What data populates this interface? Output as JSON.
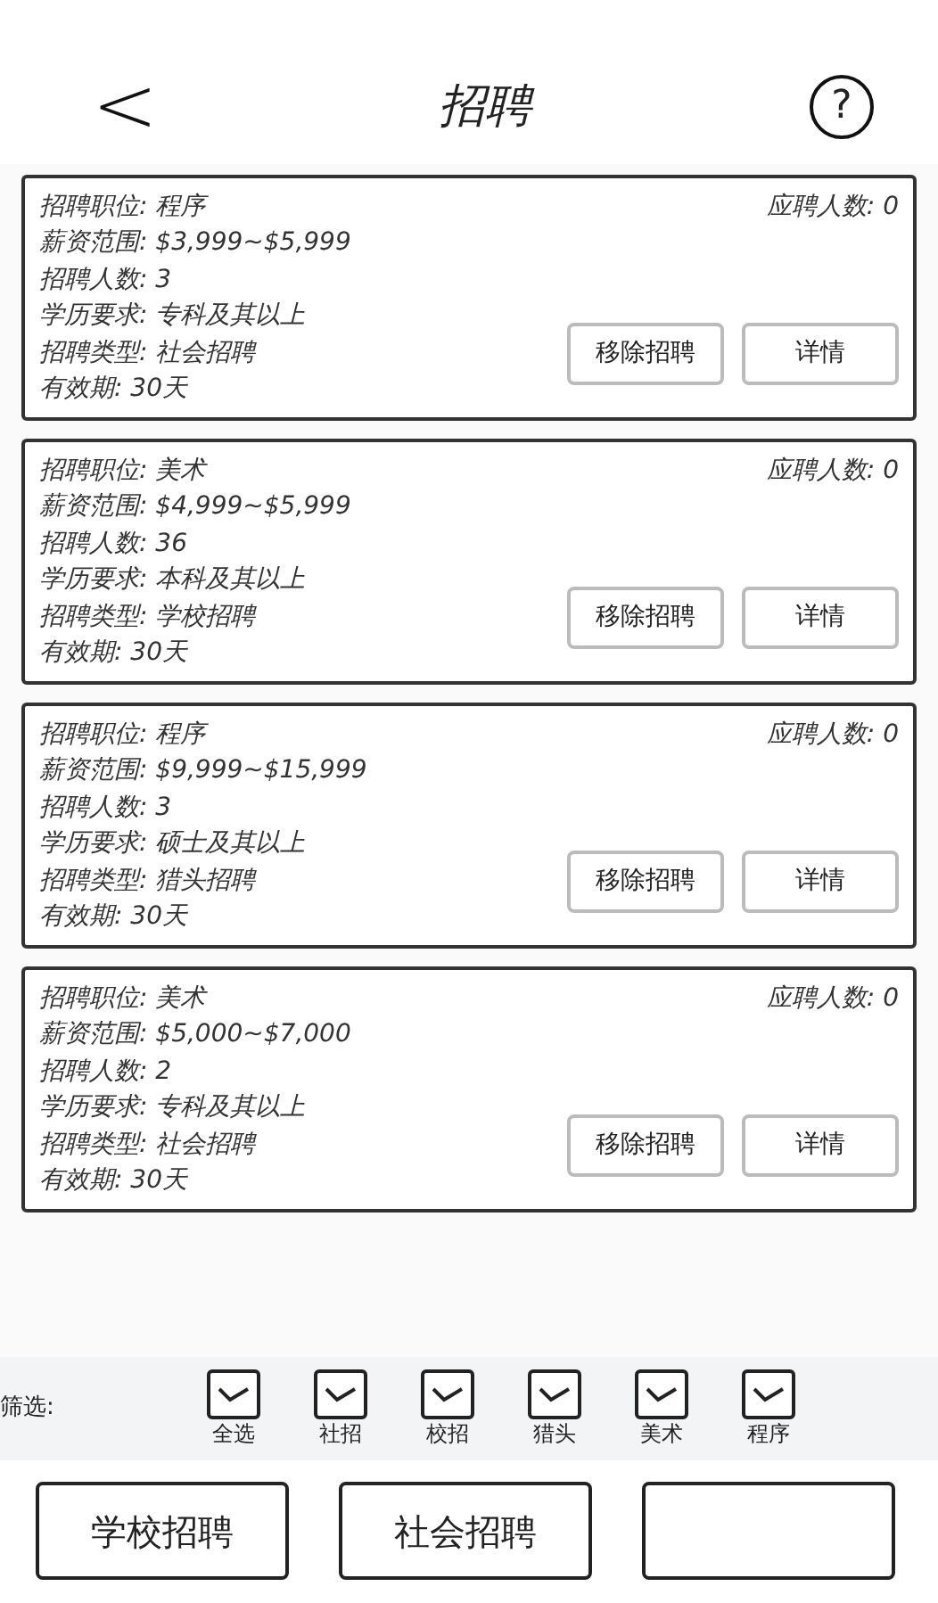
{
  "header": {
    "back": "<",
    "title": "招聘",
    "help": "?"
  },
  "postings": [
    {
      "fields": [
        "招聘职位: 程序",
        "薪资范围: $3,999~$5,999",
        "招聘人数: 3",
        "学历要求: 专科及其以上",
        "招聘类型: 社会招聘",
        "有效期: 30天"
      ],
      "applicants": "应聘人数: 0",
      "remove": "移除招聘",
      "details": "详情"
    },
    {
      "fields": [
        "招聘职位: 美术",
        "薪资范围: $4,999~$5,999",
        "招聘人数: 36",
        "学历要求: 本科及其以上",
        "招聘类型: 学校招聘",
        "有效期: 30天"
      ],
      "applicants": "应聘人数: 0",
      "remove": "移除招聘",
      "details": "详情"
    },
    {
      "fields": [
        "招聘职位: 程序",
        "薪资范围: $9,999~$15,999",
        "招聘人数: 3",
        "学历要求: 硕士及其以上",
        "招聘类型: 猎头招聘",
        "有效期: 30天"
      ],
      "applicants": "应聘人数: 0",
      "remove": "移除招聘",
      "details": "详情"
    },
    {
      "fields": [
        "招聘职位: 美术",
        "薪资范围: $5,000~$7,000",
        "招聘人数: 2",
        "学历要求: 专科及其以上",
        "招聘类型: 社会招聘",
        "有效期: 30天"
      ],
      "applicants": "应聘人数: 0",
      "remove": "移除招聘",
      "details": "详情"
    }
  ],
  "filter": {
    "label": "筛选:",
    "options": [
      {
        "label": "全选",
        "checked": true
      },
      {
        "label": "社招",
        "checked": true
      },
      {
        "label": "校招",
        "checked": true
      },
      {
        "label": "猎头",
        "checked": true
      },
      {
        "label": "美术",
        "checked": true
      },
      {
        "label": "程序",
        "checked": true
      }
    ]
  },
  "bottom_buttons": [
    "学校招聘",
    "社会招聘"
  ]
}
